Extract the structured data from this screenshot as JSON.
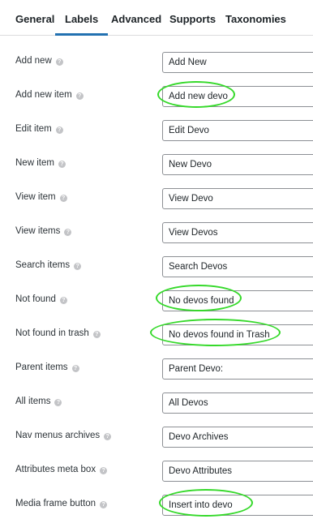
{
  "tabs": [
    {
      "label": "General",
      "active": false
    },
    {
      "label": "Labels",
      "active": true
    },
    {
      "label": "Advanced",
      "active": false
    },
    {
      "label": "Supports",
      "active": false
    },
    {
      "label": "Taxonomies",
      "active": false
    }
  ],
  "help_icon_glyph": "?",
  "fields": [
    {
      "label": "Add new",
      "value": "Add New",
      "highlighted": false
    },
    {
      "label": "Add new item",
      "value": "Add new devo",
      "highlighted": true
    },
    {
      "label": "Edit item",
      "value": "Edit Devo",
      "highlighted": false
    },
    {
      "label": "New item",
      "value": "New Devo",
      "highlighted": false
    },
    {
      "label": "View item",
      "value": "View Devo",
      "highlighted": false
    },
    {
      "label": "View items",
      "value": "View Devos",
      "highlighted": false
    },
    {
      "label": "Search items",
      "value": "Search Devos",
      "highlighted": false
    },
    {
      "label": "Not found",
      "value": "No devos found",
      "highlighted": true
    },
    {
      "label": "Not found in trash",
      "value": "No devos found in Trash",
      "highlighted": true
    },
    {
      "label": "Parent items",
      "value": "Parent Devo:",
      "highlighted": false
    },
    {
      "label": "All items",
      "value": "All Devos",
      "highlighted": false
    },
    {
      "label": "Nav menus archives",
      "value": "Devo Archives",
      "highlighted": false
    },
    {
      "label": "Attributes meta box",
      "value": "Devo Attributes",
      "highlighted": false
    },
    {
      "label": "Media frame button",
      "value": "Insert into devo",
      "highlighted": true
    }
  ],
  "colors": {
    "active_tab_underline": "#2271b1",
    "annotation_circle": "#35d92a",
    "input_border": "#8c8f94"
  }
}
